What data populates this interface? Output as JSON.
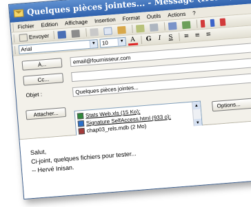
{
  "window": {
    "title": "Quelques pièces jointes... - Message (HTML)"
  },
  "menu": [
    "Fichier",
    "Edition",
    "Affichage",
    "Insertion",
    "Format",
    "Outils",
    "Actions",
    "?"
  ],
  "toolbar": {
    "send_label": "Envoyer"
  },
  "format": {
    "font": "Arial",
    "size": "10"
  },
  "fields": {
    "to_button": "À...",
    "to_value": "email@fournisseur.com",
    "cc_button": "Cc...",
    "cc_value": "",
    "subject_label": "Objet :",
    "subject_value": "Quelques pièces jointes...",
    "attach_button": "Attacher...",
    "options_button": "Options..."
  },
  "attachments": [
    {
      "name": "Stats Web.xls (15 Ko);",
      "icon": "excel-icon",
      "color": "#2f8a3b"
    },
    {
      "name": "Signature SelfAccess.html (933 o);",
      "icon": "html-icon",
      "color": "#2a6fc9"
    },
    {
      "name": "chap03_rels.mdb (2 Mo)",
      "icon": "access-icon",
      "color": "#a33a3a"
    }
  ],
  "message": {
    "line1": "Salut,",
    "line2": "Ci-joint, quelques fichiers pour tester...",
    "line3": "-- Hervé Inisan."
  }
}
